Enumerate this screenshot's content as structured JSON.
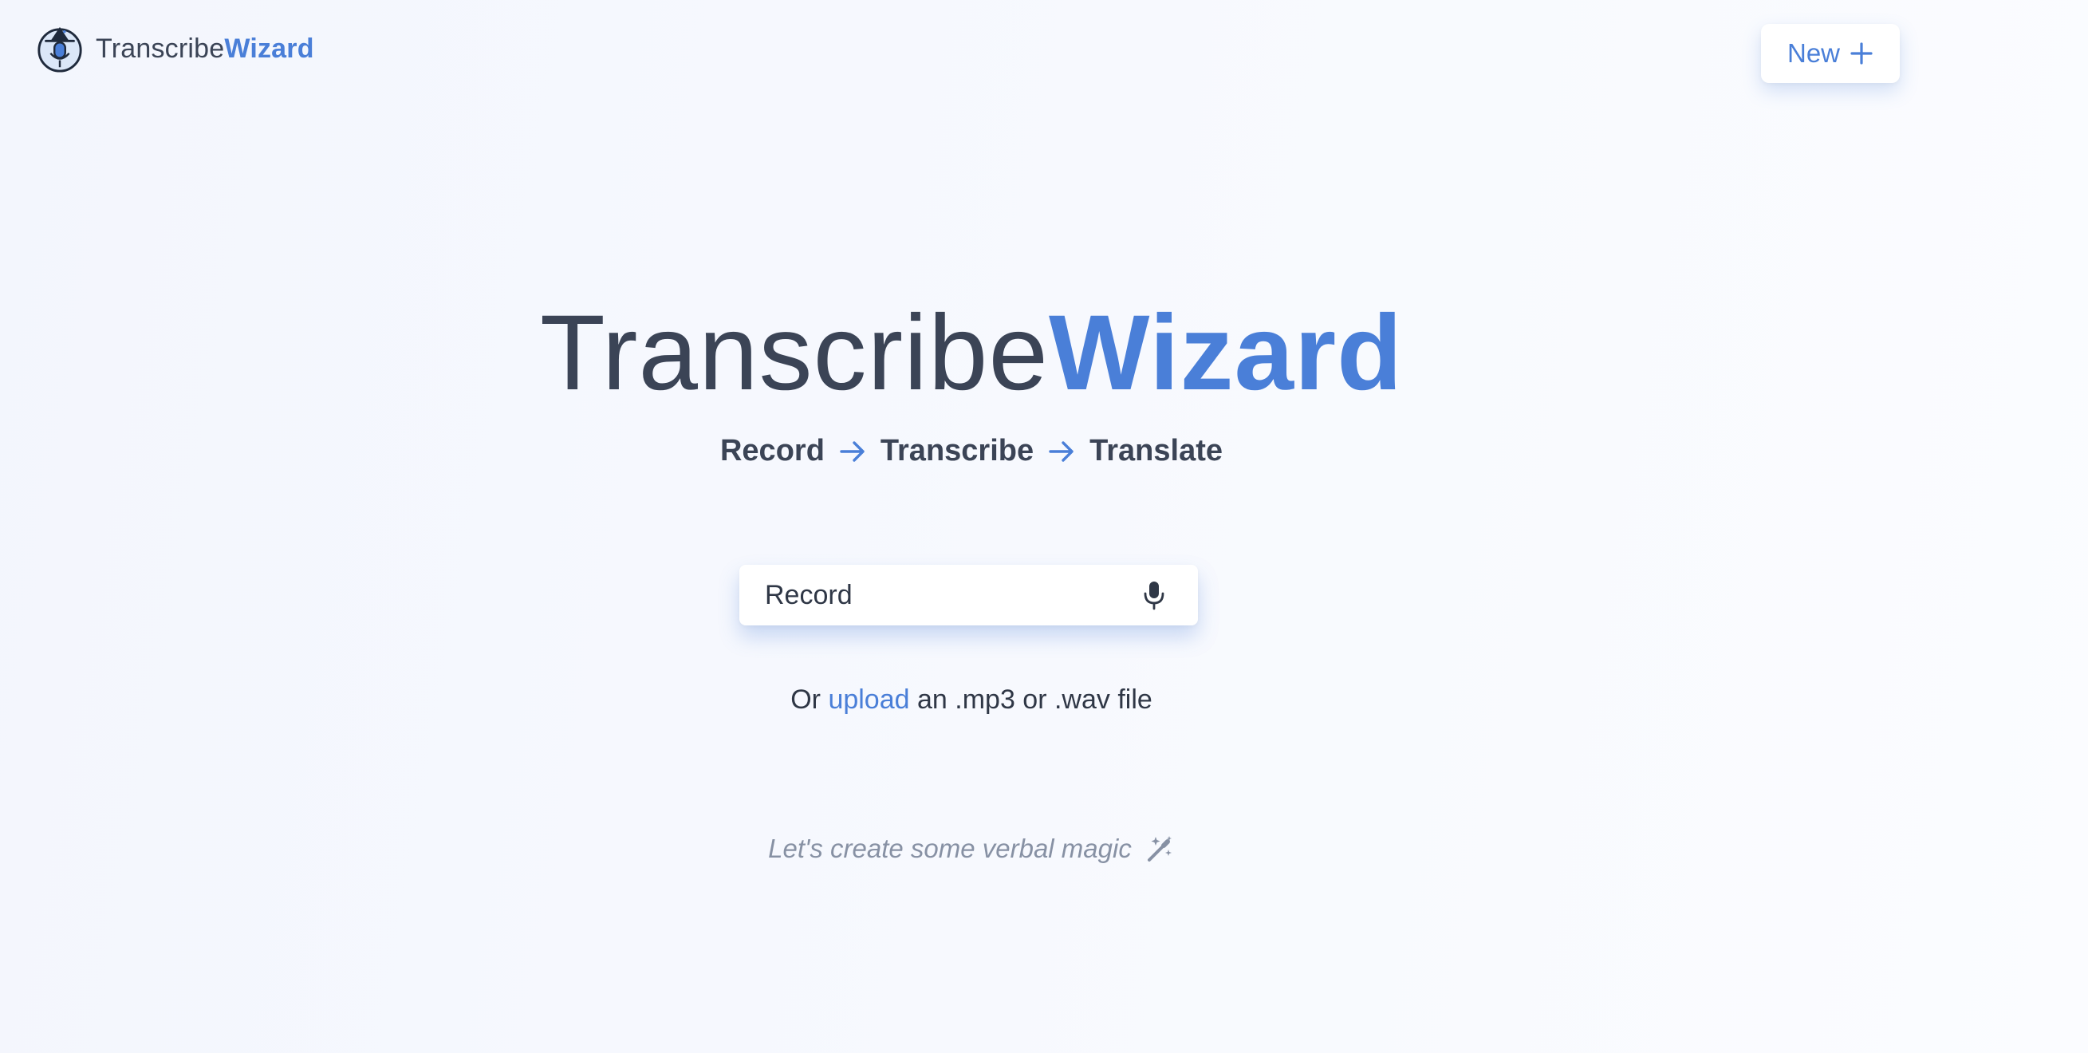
{
  "header": {
    "logo_text_part1": "Transcribe",
    "logo_text_part2": "Wizard",
    "new_button_label": "New",
    "logo_icon": "wizard-microphone-icon",
    "new_button_icon": "plus-icon"
  },
  "hero": {
    "title_part1": "Transcribe",
    "title_part2": "Wizard",
    "steps": [
      "Record",
      "Transcribe",
      "Translate"
    ],
    "step_separator_icon": "arrow-right-icon"
  },
  "record": {
    "label": "Record",
    "icon": "microphone-icon"
  },
  "upload": {
    "prefix": "Or",
    "link_text": "upload",
    "suffix": "an .mp3 or .wav file"
  },
  "tagline": {
    "text": "Let's create some verbal magic",
    "icon": "magic-wand-icon"
  },
  "colors": {
    "accent": "#4a7fd8",
    "text_dark": "#3b4456",
    "text_muted": "#8791a4",
    "background": "#f5f7fd"
  }
}
